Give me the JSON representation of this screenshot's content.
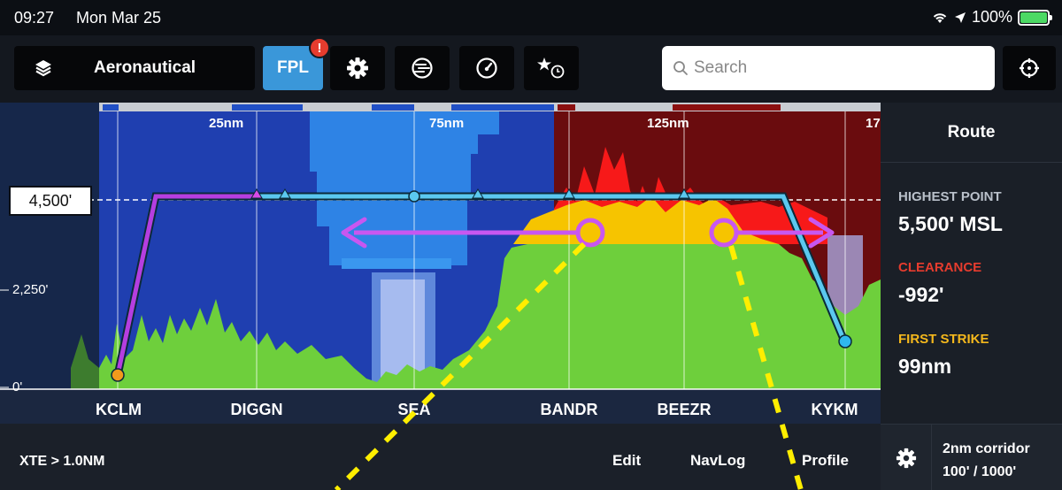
{
  "status": {
    "time": "09:27",
    "date": "Mon Mar 25",
    "battery": "100%"
  },
  "toolbar": {
    "layers_label": "Aeronautical",
    "fpl_label": "FPL",
    "fpl_badge": "!",
    "search_placeholder": "Search"
  },
  "profile": {
    "distance_labels": [
      "25nm",
      "75nm",
      "125nm",
      "17"
    ],
    "altitude_box": "4,500'",
    "y_labels": [
      "2,250'",
      "0'"
    ],
    "waypoints": [
      "KCLM",
      "DIGGN",
      "SEA",
      "BANDR",
      "BEEZR",
      "KYKM"
    ]
  },
  "route_panel": {
    "title": "Route",
    "highest_label": "HIGHEST POINT",
    "highest_value": "5,500' MSL",
    "clearance_label": "CLEARANCE",
    "clearance_value": "-992'",
    "first_strike_label": "FIRST STRIKE",
    "first_strike_value": "99nm"
  },
  "bottom": {
    "xte": "XTE > 1.0NM",
    "tabs": [
      "Edit",
      "NavLog",
      "Profile"
    ],
    "corridor_line1": "2nm corridor",
    "corridor_line2": "100' / 1000'"
  },
  "colors": {
    "accent": "#3a97d9",
    "route_line": "#5bc8ef",
    "climb_line": "#b53ee0",
    "terrain_green": "#6ecf3c",
    "terrain_yellow": "#f6c400",
    "terrain_red": "#ff1a1a",
    "danger": "#e63c2e",
    "caution": "#f5b81c",
    "annotation_yellow": "#ffee00",
    "annotation_purple": "#c857f0"
  }
}
